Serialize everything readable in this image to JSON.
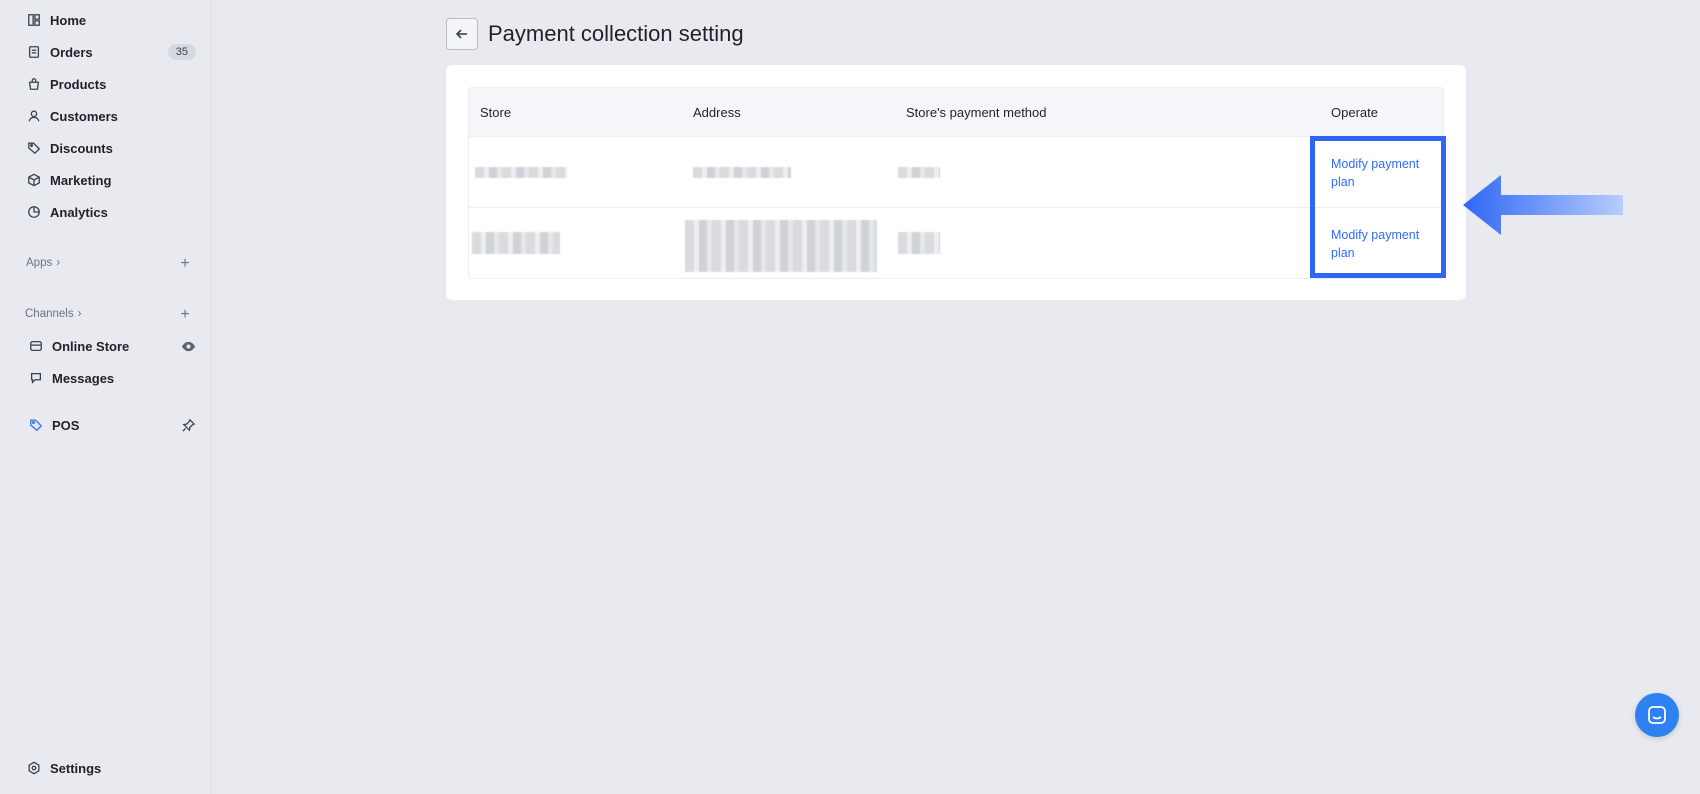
{
  "sidebar": {
    "nav": [
      {
        "label": "Home",
        "icon": "home-grid-icon"
      },
      {
        "label": "Orders",
        "icon": "orders-icon",
        "badge": "35"
      },
      {
        "label": "Products",
        "icon": "bag-icon"
      },
      {
        "label": "Customers",
        "icon": "person-icon"
      },
      {
        "label": "Discounts",
        "icon": "tag-icon"
      },
      {
        "label": "Marketing",
        "icon": "cube-icon"
      },
      {
        "label": "Analytics",
        "icon": "pie-chart-icon"
      }
    ],
    "apps_label": "Apps",
    "channels_label": "Channels",
    "channels": [
      {
        "label": "Online Store",
        "icon": "store-icon"
      },
      {
        "label": "Messages",
        "icon": "chat-icon"
      }
    ],
    "pos_label": "POS",
    "settings_label": "Settings"
  },
  "header": {
    "title": "Payment collection setting"
  },
  "table": {
    "columns": [
      "Store",
      "Address",
      "Store's payment method",
      "Operate"
    ],
    "rows": [
      {
        "operate": "Modify payment plan"
      },
      {
        "operate": "Modify payment plan"
      }
    ]
  },
  "colors": {
    "accent": "#2f6bff",
    "highlight": "#2f66f5",
    "chat": "#2f80f0"
  }
}
